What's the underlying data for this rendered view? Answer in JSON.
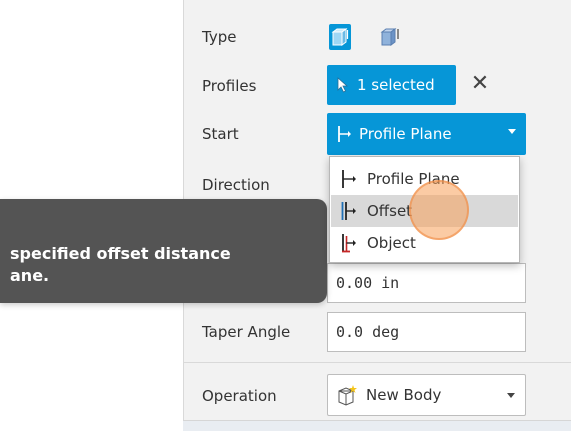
{
  "panel": {
    "type_label": "Type",
    "profiles_label": "Profiles",
    "profiles_value": "1 selected",
    "clear_symbol": "✕",
    "start_label": "Start",
    "start_value": "Profile Plane",
    "direction_label": "Direction",
    "distance_value": "0.00 in",
    "taper_label": "Taper Angle",
    "taper_value": "0.0 deg",
    "operation_label": "Operation",
    "operation_value": "New Body"
  },
  "start_menu": {
    "items": [
      {
        "label": "Profile Plane",
        "icon": "profile-plane-icon"
      },
      {
        "label": "Offset",
        "icon": "offset-icon"
      },
      {
        "label": "Object",
        "icon": "object-icon"
      }
    ],
    "hovered": "Offset"
  },
  "tooltip": {
    "line1": "specified offset distance",
    "line2": "ane."
  },
  "colors": {
    "accent": "#0696d7",
    "tooltip_bg": "#545454",
    "click_indicator": "#f7a05a"
  }
}
